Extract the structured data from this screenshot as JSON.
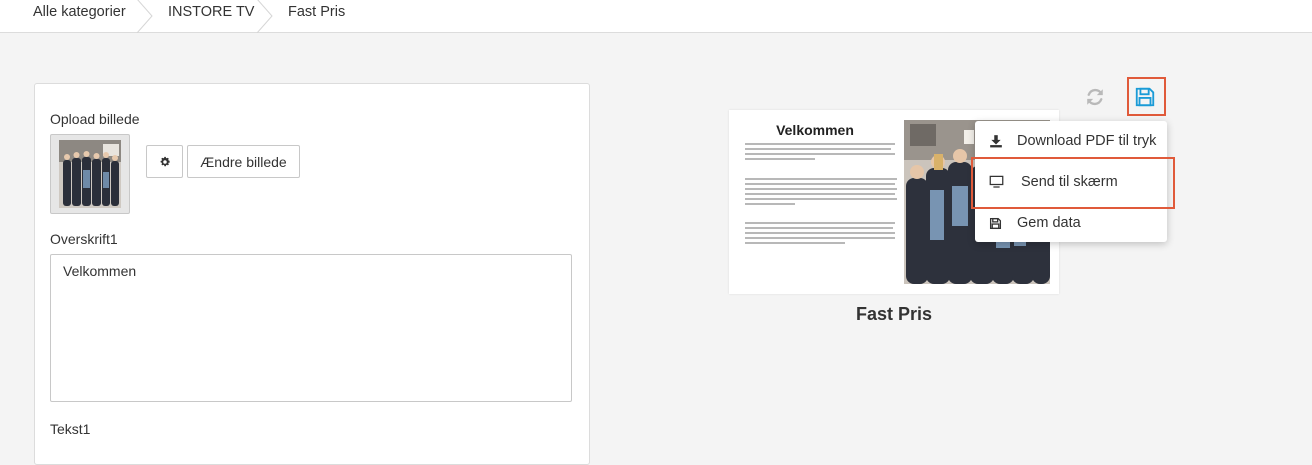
{
  "breadcrumb": {
    "items": [
      "Alle kategorier",
      "INSTORE TV",
      "Fast Pris"
    ]
  },
  "form": {
    "upload_label": "Opload billede",
    "change_image_label": "Ændre billede",
    "heading1_label": "Overskrift1",
    "heading1_value": "Velkommen",
    "text1_label": "Tekst1"
  },
  "preview": {
    "headline": "Velkommen",
    "caption": "Fast Pris"
  },
  "menu": {
    "items": [
      {
        "label": "Download PDF til tryk",
        "icon": "download-icon"
      },
      {
        "label": "Send til skærm",
        "icon": "monitor-icon"
      },
      {
        "label": "Gem data",
        "icon": "save-icon"
      }
    ]
  },
  "colors": {
    "accent": "#1a9bd7",
    "highlight": "#e05a3a"
  }
}
